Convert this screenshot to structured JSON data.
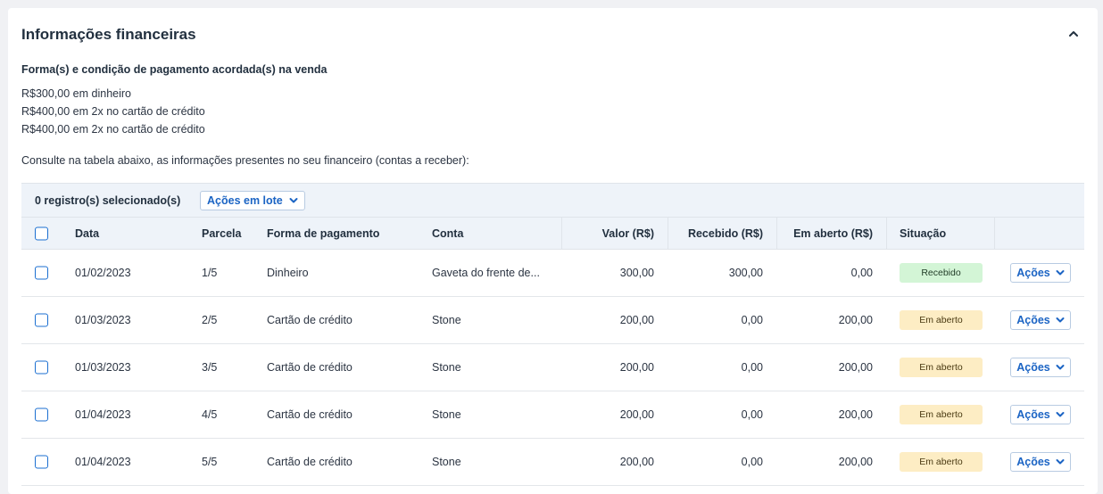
{
  "section": {
    "title": "Informações financeiras",
    "subtitle": "Forma(s) e condição de pagamento acordada(s) na venda",
    "conditions": [
      "R$300,00 em dinheiro",
      "R$400,00 em 2x no cartão de crédito",
      "R$400,00 em 2x no cartão de crédito"
    ],
    "intro": "Consulte na tabela abaixo, as informações presentes no seu financeiro (contas a receber):"
  },
  "toolbar": {
    "selected_text": "0 registro(s) selecionado(s)",
    "batch_label": "Ações em lote"
  },
  "columns": {
    "data": "Data",
    "parcela": "Parcela",
    "forma": "Forma de pagamento",
    "conta": "Conta",
    "valor": "Valor (R$)",
    "recebido": "Recebido (R$)",
    "aberto": "Em aberto (R$)",
    "situacao": "Situação"
  },
  "rows": [
    {
      "data": "01/02/2023",
      "parcela": "1/5",
      "forma": "Dinheiro",
      "conta": "Gaveta do frente de...",
      "valor": "300,00",
      "recebido": "300,00",
      "aberto": "0,00",
      "situacao": "Recebido",
      "acoes": "Ações"
    },
    {
      "data": "01/03/2023",
      "parcela": "2/5",
      "forma": "Cartão de crédito",
      "conta": "Stone",
      "valor": "200,00",
      "recebido": "0,00",
      "aberto": "200,00",
      "situacao": "Em aberto",
      "acoes": "Ações"
    },
    {
      "data": "01/03/2023",
      "parcela": "3/5",
      "forma": "Cartão de crédito",
      "conta": "Stone",
      "valor": "200,00",
      "recebido": "0,00",
      "aberto": "200,00",
      "situacao": "Em aberto",
      "acoes": "Ações"
    },
    {
      "data": "01/04/2023",
      "parcela": "4/5",
      "forma": "Cartão de crédito",
      "conta": "Stone",
      "valor": "200,00",
      "recebido": "0,00",
      "aberto": "200,00",
      "situacao": "Em aberto",
      "acoes": "Ações"
    },
    {
      "data": "01/04/2023",
      "parcela": "5/5",
      "forma": "Cartão de crédito",
      "conta": "Stone",
      "valor": "200,00",
      "recebido": "0,00",
      "aberto": "200,00",
      "situacao": "Em aberto",
      "acoes": "Ações"
    }
  ],
  "colors": {
    "accent": "#1b64c4",
    "received_bg": "#d3f5d6",
    "open_bg": "#fdedc4",
    "header_bg": "#eef3f9"
  },
  "icons": {
    "collapse": "chevron-up-icon",
    "dropdown": "chevron-down-icon",
    "checkbox": "checkbox-icon"
  }
}
